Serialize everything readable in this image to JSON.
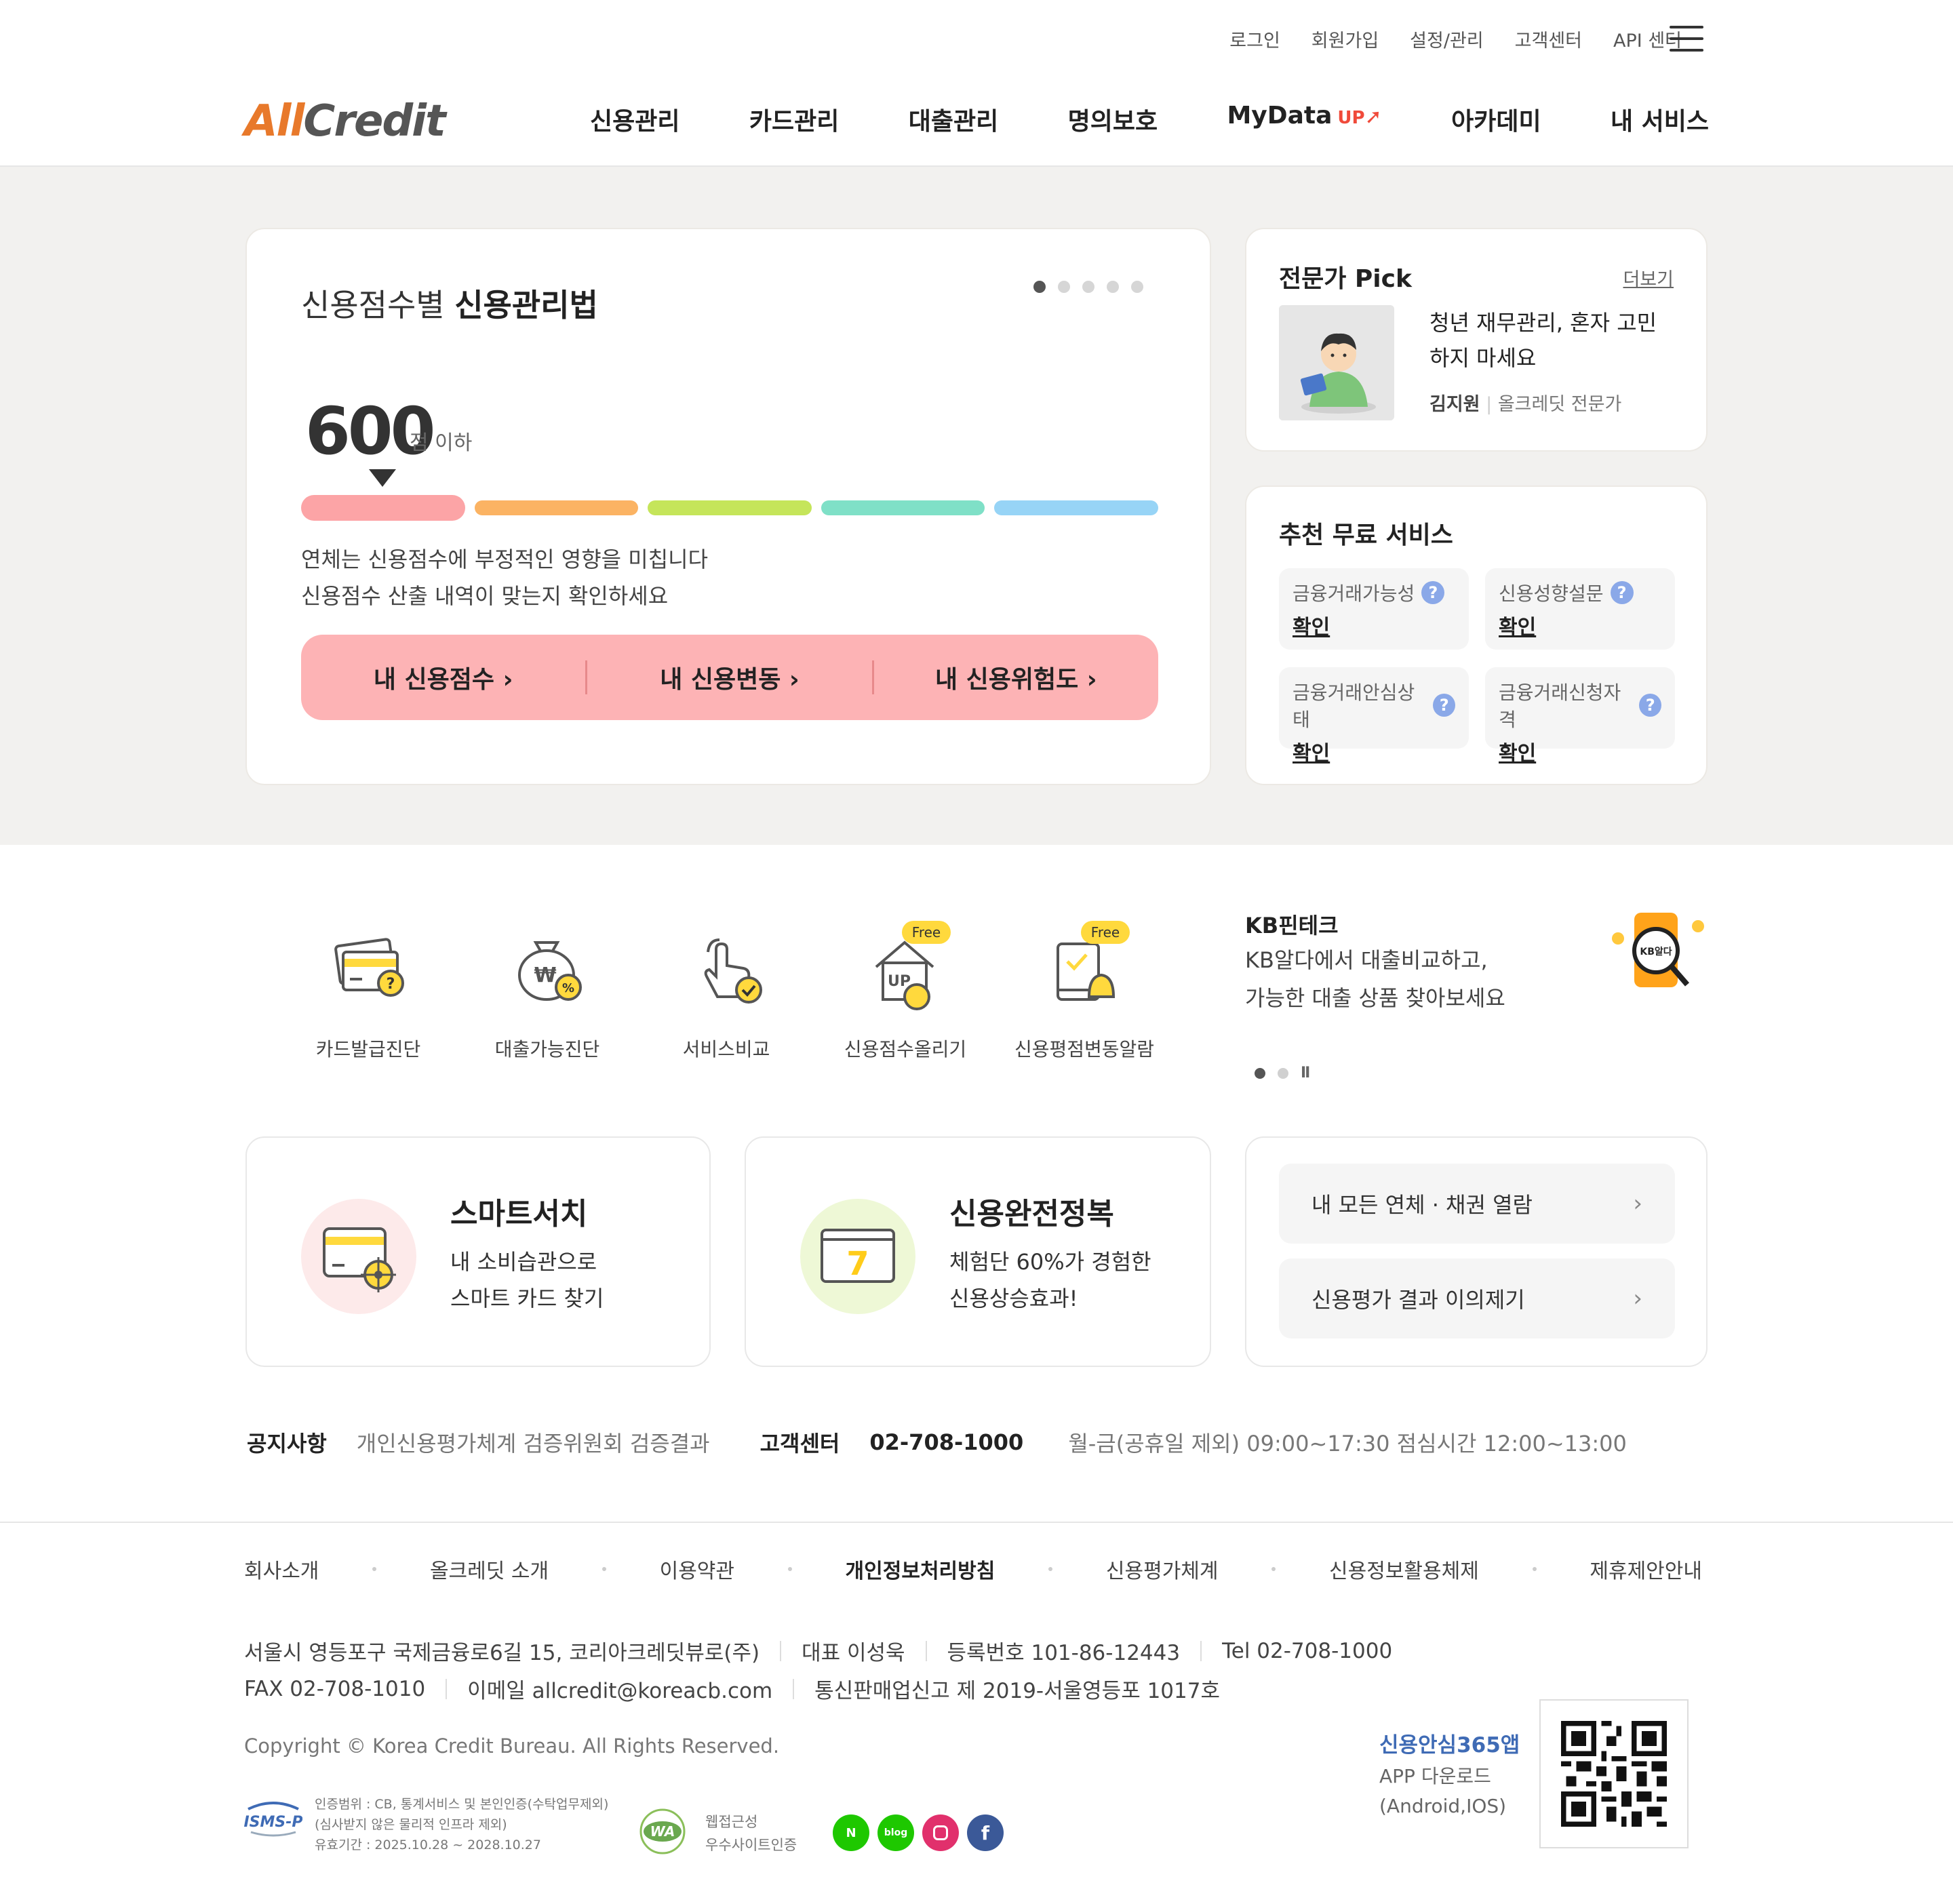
{
  "util_nav": [
    "로그인",
    "회원가입",
    "설정/관리",
    "고객센터",
    "API 센터"
  ],
  "logo": {
    "part1": "All",
    "part2": "Credit"
  },
  "gnb": [
    "신용관리",
    "카드관리",
    "대출관리",
    "명의보호",
    "MyData",
    "아카데미",
    "내 서비스"
  ],
  "gnb_badge": "UP",
  "credit_card": {
    "title_light": "신용점수별",
    "title_bold": "신용관리법",
    "slide_count": 5,
    "active_slide": 1,
    "score": "600",
    "score_unit": "점 이하",
    "desc1": "연체는 신용점수에 부정적인 영향을 미칩니다",
    "desc2": "신용점수 산출 내역이 맞는지 확인하세요",
    "buttons": [
      "내 신용점수 ›",
      "내 신용변동 ›",
      "내 신용위험도 ›"
    ],
    "bar_colors": [
      "#fca4a6",
      "#fbb363",
      "#c5e55a",
      "#7fe0c7",
      "#97d4f6"
    ]
  },
  "expert": {
    "title": "전문가 Pick",
    "more": "더보기",
    "line1": "청년 재무관리, 혼자 고민",
    "line2": "하지 마세요",
    "author": "김지원",
    "role": "올크레딧 전문가"
  },
  "free_services": {
    "title": "추천 무료 서비스",
    "items": [
      {
        "label": "금융거래가능성",
        "action": "확인"
      },
      {
        "label": "신용성향설문",
        "action": "확인"
      },
      {
        "label": "금융거래안심상태",
        "action": "확인"
      },
      {
        "label": "금융거래신청자격",
        "action": "확인"
      }
    ]
  },
  "quick": [
    {
      "label": "카드발급진단"
    },
    {
      "label": "대출가능진단"
    },
    {
      "label": "서비스비교"
    },
    {
      "label": "신용점수올리기",
      "badge": "Free"
    },
    {
      "label": "신용평점변동알람",
      "badge": "Free"
    }
  ],
  "kb": {
    "title": "KB핀테크",
    "line1": "KB알다에서 대출비교하고,",
    "line2": "가능한 대출 상품 찾아보세요",
    "icon_text": "KB알다",
    "pause": "II"
  },
  "promo": [
    {
      "title": "스마트서치",
      "line1": "내 소비습관으로",
      "line2": "스마트 카드 찾기"
    },
    {
      "title": "신용완전정복",
      "line1": "체험단 60%가 경험한",
      "line2": "신용상승효과!"
    }
  ],
  "links": [
    "내 모든 연체 · 채권 열람",
    "신용평가 결과 이의제기"
  ],
  "notice": {
    "label": "공지사항",
    "text": "개인신용평가체계 검증위원회 검증결과",
    "cs_label": "고객센터",
    "cs_phone": "02-708-1000",
    "hours": "월-금(공휴일 제외) 09:00~17:30 점심시간 12:00~13:00"
  },
  "footer_nav": [
    "회사소개",
    "올크레딧 소개",
    "이용약관",
    "개인정보처리방침",
    "신용평가체계",
    "신용정보활용체제",
    "제휴제안안내"
  ],
  "footer_info": {
    "address": "서울시 영등포구 국제금융로6길 15, 코리아크레딧뷰로(주)",
    "ceo": "대표  이성욱",
    "reg": "등록번호  101-86-12443",
    "tel": "Tel  02-708-1000",
    "fax": "FAX  02-708-1010",
    "email": "이메일  allcredit@koreacb.com",
    "ecommerce": "통신판매업신고  제 2019-서울영등포 1017호",
    "copyright": "Copyright © Korea Credit Bureau. All Rights Reserved."
  },
  "cert": {
    "isms_logo": "ISMS-P",
    "isms1": "인증범위 : CB, 통계서비스 및 본인인증(수탁업무제외)",
    "isms2": "(심사받지 않은 물리적 인프라 제외)",
    "isms3": "유효기간 : 2025.10.28 ~ 2028.10.27",
    "wa_logo": "WA",
    "wa1": "웹접근성",
    "wa2": "우수사이트인증"
  },
  "sns": [
    "N",
    "blog",
    "instagram",
    "facebook"
  ],
  "app": {
    "title": "신용안심365앱",
    "line1": "APP 다운로드",
    "line2": "(Android,IOS)"
  }
}
